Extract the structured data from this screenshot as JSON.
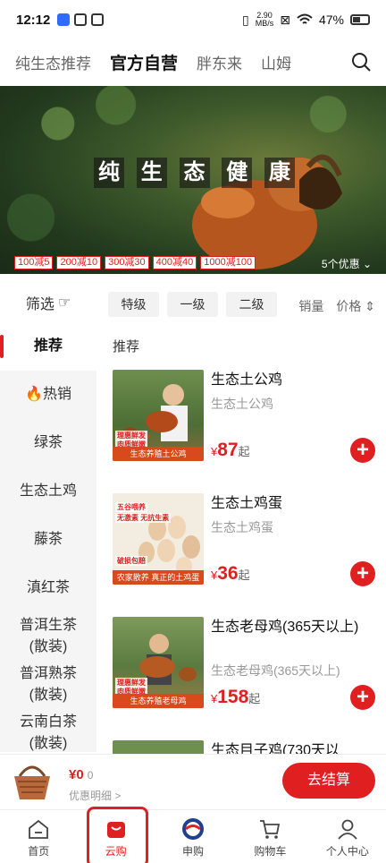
{
  "status": {
    "time": "12:12",
    "speed_top": "2.90",
    "speed_bottom": "MB/s",
    "battery": "47%"
  },
  "top_tabs": [
    {
      "label": "纯生态推荐"
    },
    {
      "label": "官方自营"
    },
    {
      "label": "胖东来"
    },
    {
      "label": "山姆"
    }
  ],
  "banner": {
    "slogan": [
      "纯",
      "生",
      "态",
      "健",
      "康"
    ],
    "coupons": [
      "100减5",
      "200减10",
      "300减30",
      "400减40",
      "1000减100"
    ],
    "promo_count": "5个优惠"
  },
  "filter": {
    "label": "筛选",
    "grades": [
      "特级",
      "一级",
      "二级"
    ],
    "sort_sales": "销量",
    "sort_price": "价格"
  },
  "sidebar": {
    "items": [
      {
        "label": "推荐"
      },
      {
        "label": "🔥热销"
      },
      {
        "label": "绿茶"
      },
      {
        "label": "生态土鸡"
      },
      {
        "label": "藤茶"
      },
      {
        "label": "滇红茶"
      },
      {
        "label": "普洱生茶(散装)"
      },
      {
        "label": "普洱熟茶(散装)"
      },
      {
        "label": "云南白茶(散装)"
      }
    ]
  },
  "section_title": "推荐",
  "products": [
    {
      "name": "生态土公鸡",
      "subtitle": "生态土公鸡",
      "price": "87",
      "unit": "起",
      "img_label": "生态养殖土公鸡",
      "tag_a": "理惠鲜发",
      "tag_b": "肉质鲜嫩"
    },
    {
      "name": "生态土鸡蛋",
      "subtitle": "生态土鸡蛋",
      "price": "36",
      "unit": "起",
      "img_label": "农家散养 真正的土鸡蛋",
      "tag_a": "五谷喂养",
      "tag_b": "无激素 无抗生素",
      "tag_c": "破损包赔"
    },
    {
      "name": "生态老母鸡(365天以上)",
      "subtitle": "生态老母鸡(365天以上)",
      "price": "158",
      "unit": "起",
      "img_label": "生态养殖老母鸡",
      "tag_a": "理惠鲜发",
      "tag_b": "肉质鲜嫩"
    },
    {
      "name": "生态目子鸡(730天以",
      "subtitle": "",
      "price": "",
      "unit": ""
    }
  ],
  "cart": {
    "price": "¥0",
    "count": "0",
    "detail": "优惠明细 >",
    "checkout": "去结算"
  },
  "bottom_nav": [
    {
      "label": "首页"
    },
    {
      "label": "云购"
    },
    {
      "label": "申购"
    },
    {
      "label": "购物车"
    },
    {
      "label": "个人中心"
    }
  ],
  "colors": {
    "accent": "#e02020"
  }
}
